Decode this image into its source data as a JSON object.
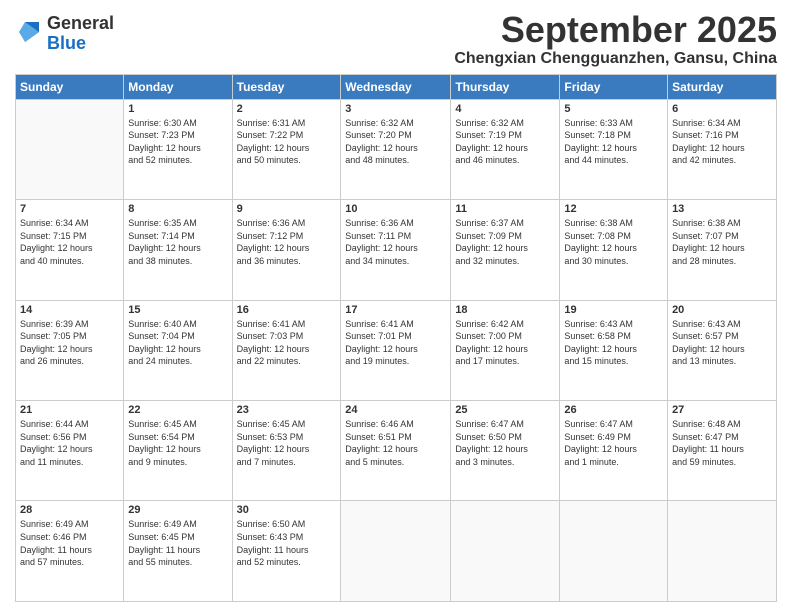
{
  "logo": {
    "general": "General",
    "blue": "Blue"
  },
  "header": {
    "month": "September 2025",
    "location": "Chengxian Chengguanzhen, Gansu, China"
  },
  "days_header": [
    "Sunday",
    "Monday",
    "Tuesday",
    "Wednesday",
    "Thursday",
    "Friday",
    "Saturday"
  ],
  "weeks": [
    [
      {
        "day": "",
        "info": ""
      },
      {
        "day": "1",
        "info": "Sunrise: 6:30 AM\nSunset: 7:23 PM\nDaylight: 12 hours\nand 52 minutes."
      },
      {
        "day": "2",
        "info": "Sunrise: 6:31 AM\nSunset: 7:22 PM\nDaylight: 12 hours\nand 50 minutes."
      },
      {
        "day": "3",
        "info": "Sunrise: 6:32 AM\nSunset: 7:20 PM\nDaylight: 12 hours\nand 48 minutes."
      },
      {
        "day": "4",
        "info": "Sunrise: 6:32 AM\nSunset: 7:19 PM\nDaylight: 12 hours\nand 46 minutes."
      },
      {
        "day": "5",
        "info": "Sunrise: 6:33 AM\nSunset: 7:18 PM\nDaylight: 12 hours\nand 44 minutes."
      },
      {
        "day": "6",
        "info": "Sunrise: 6:34 AM\nSunset: 7:16 PM\nDaylight: 12 hours\nand 42 minutes."
      }
    ],
    [
      {
        "day": "7",
        "info": "Sunrise: 6:34 AM\nSunset: 7:15 PM\nDaylight: 12 hours\nand 40 minutes."
      },
      {
        "day": "8",
        "info": "Sunrise: 6:35 AM\nSunset: 7:14 PM\nDaylight: 12 hours\nand 38 minutes."
      },
      {
        "day": "9",
        "info": "Sunrise: 6:36 AM\nSunset: 7:12 PM\nDaylight: 12 hours\nand 36 minutes."
      },
      {
        "day": "10",
        "info": "Sunrise: 6:36 AM\nSunset: 7:11 PM\nDaylight: 12 hours\nand 34 minutes."
      },
      {
        "day": "11",
        "info": "Sunrise: 6:37 AM\nSunset: 7:09 PM\nDaylight: 12 hours\nand 32 minutes."
      },
      {
        "day": "12",
        "info": "Sunrise: 6:38 AM\nSunset: 7:08 PM\nDaylight: 12 hours\nand 30 minutes."
      },
      {
        "day": "13",
        "info": "Sunrise: 6:38 AM\nSunset: 7:07 PM\nDaylight: 12 hours\nand 28 minutes."
      }
    ],
    [
      {
        "day": "14",
        "info": "Sunrise: 6:39 AM\nSunset: 7:05 PM\nDaylight: 12 hours\nand 26 minutes."
      },
      {
        "day": "15",
        "info": "Sunrise: 6:40 AM\nSunset: 7:04 PM\nDaylight: 12 hours\nand 24 minutes."
      },
      {
        "day": "16",
        "info": "Sunrise: 6:41 AM\nSunset: 7:03 PM\nDaylight: 12 hours\nand 22 minutes."
      },
      {
        "day": "17",
        "info": "Sunrise: 6:41 AM\nSunset: 7:01 PM\nDaylight: 12 hours\nand 19 minutes."
      },
      {
        "day": "18",
        "info": "Sunrise: 6:42 AM\nSunset: 7:00 PM\nDaylight: 12 hours\nand 17 minutes."
      },
      {
        "day": "19",
        "info": "Sunrise: 6:43 AM\nSunset: 6:58 PM\nDaylight: 12 hours\nand 15 minutes."
      },
      {
        "day": "20",
        "info": "Sunrise: 6:43 AM\nSunset: 6:57 PM\nDaylight: 12 hours\nand 13 minutes."
      }
    ],
    [
      {
        "day": "21",
        "info": "Sunrise: 6:44 AM\nSunset: 6:56 PM\nDaylight: 12 hours\nand 11 minutes."
      },
      {
        "day": "22",
        "info": "Sunrise: 6:45 AM\nSunset: 6:54 PM\nDaylight: 12 hours\nand 9 minutes."
      },
      {
        "day": "23",
        "info": "Sunrise: 6:45 AM\nSunset: 6:53 PM\nDaylight: 12 hours\nand 7 minutes."
      },
      {
        "day": "24",
        "info": "Sunrise: 6:46 AM\nSunset: 6:51 PM\nDaylight: 12 hours\nand 5 minutes."
      },
      {
        "day": "25",
        "info": "Sunrise: 6:47 AM\nSunset: 6:50 PM\nDaylight: 12 hours\nand 3 minutes."
      },
      {
        "day": "26",
        "info": "Sunrise: 6:47 AM\nSunset: 6:49 PM\nDaylight: 12 hours\nand 1 minute."
      },
      {
        "day": "27",
        "info": "Sunrise: 6:48 AM\nSunset: 6:47 PM\nDaylight: 11 hours\nand 59 minutes."
      }
    ],
    [
      {
        "day": "28",
        "info": "Sunrise: 6:49 AM\nSunset: 6:46 PM\nDaylight: 11 hours\nand 57 minutes."
      },
      {
        "day": "29",
        "info": "Sunrise: 6:49 AM\nSunset: 6:45 PM\nDaylight: 11 hours\nand 55 minutes."
      },
      {
        "day": "30",
        "info": "Sunrise: 6:50 AM\nSunset: 6:43 PM\nDaylight: 11 hours\nand 52 minutes."
      },
      {
        "day": "",
        "info": ""
      },
      {
        "day": "",
        "info": ""
      },
      {
        "day": "",
        "info": ""
      },
      {
        "day": "",
        "info": ""
      }
    ]
  ]
}
